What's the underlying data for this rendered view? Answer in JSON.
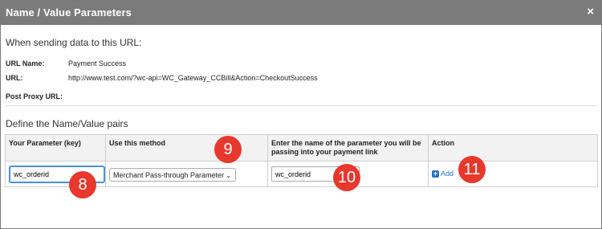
{
  "dialog": {
    "title": "Name / Value Parameters",
    "close_glyph": "×"
  },
  "intro": "When sending data to this URL:",
  "fields": [
    {
      "label": "URL Name:",
      "value": "Payment Success"
    },
    {
      "label": "URL:",
      "value": "http://www.test.com/?wc-api=WC_Gateway_CCBill&Action=CheckoutSuccess"
    },
    {
      "label": "Post Proxy URL:",
      "value": ""
    }
  ],
  "define_title": "Define the Name/Value pairs",
  "table": {
    "headers": [
      "Your Parameter (key)",
      "Use this method",
      "Enter the name of the parameter you will be passing into your payment link",
      "Action"
    ],
    "row": {
      "key": "wc_orderid",
      "method": "Merchant Pass-through Parameter",
      "name": "wc_orderid",
      "action_label": "Add"
    }
  },
  "badges": [
    "8",
    "9",
    "10",
    "11"
  ],
  "colors": {
    "titlebar": "#7b7b7b",
    "badge": "#e8372c",
    "link": "#2a6fc9",
    "focus": "#4a90e2"
  }
}
